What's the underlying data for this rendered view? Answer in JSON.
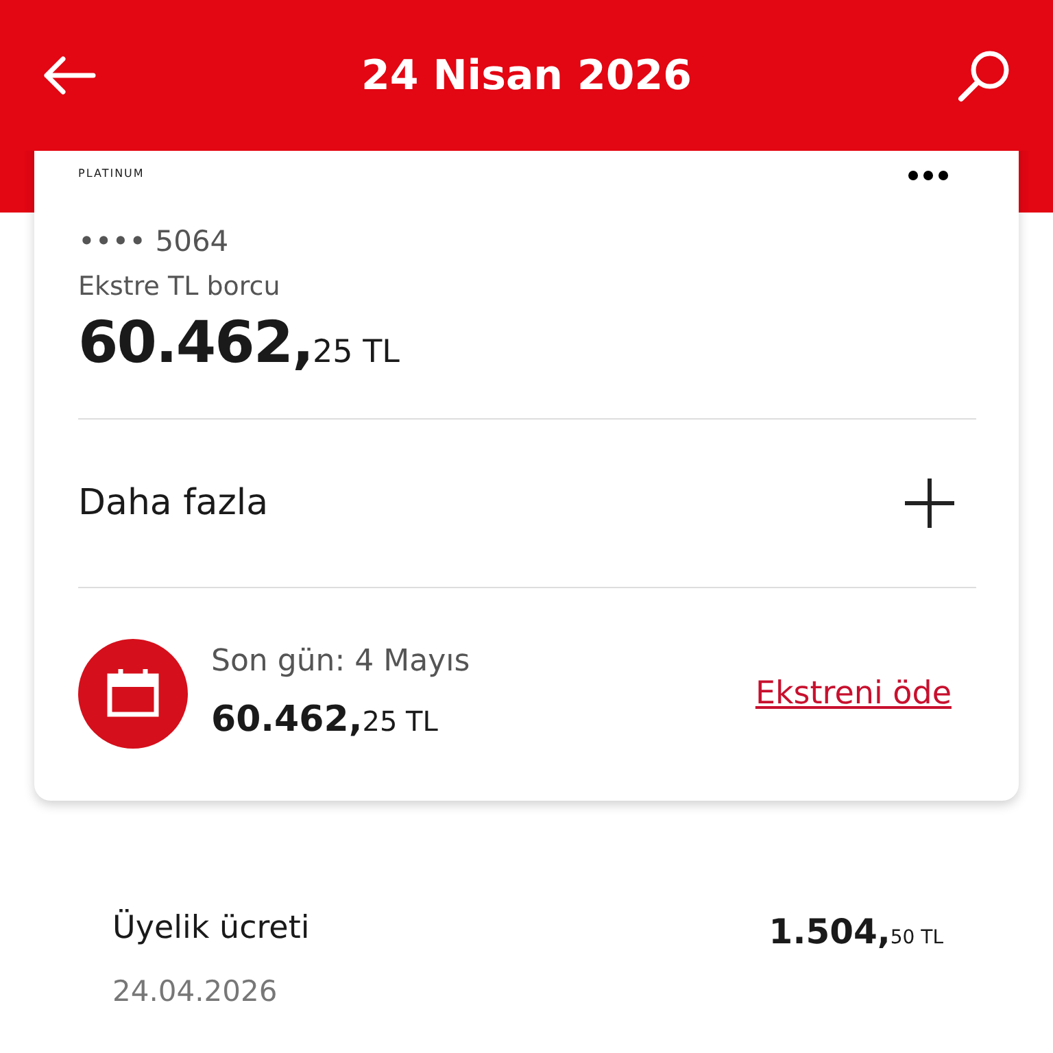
{
  "header": {
    "title": "24 Nisan 2026"
  },
  "card": {
    "tier": "PLATINUM",
    "card_number": "•••• 5064",
    "debt_label": "Ekstre TL borcu",
    "debt_amount": {
      "main": "60.462,",
      "fraction": "25 TL"
    },
    "more": {
      "label": "Daha fazla",
      "expanded": false
    },
    "due": {
      "label": "Son gün: 4 Mayıs",
      "amount": {
        "main": "60.462,",
        "fraction": "25 TL"
      },
      "action": "Ekstreni öde"
    }
  },
  "transactions": [
    {
      "title": "Üyelik ücreti",
      "date": "24.04.2026",
      "amount": {
        "main": "1.504,",
        "fraction": "50 TL"
      }
    }
  ]
}
